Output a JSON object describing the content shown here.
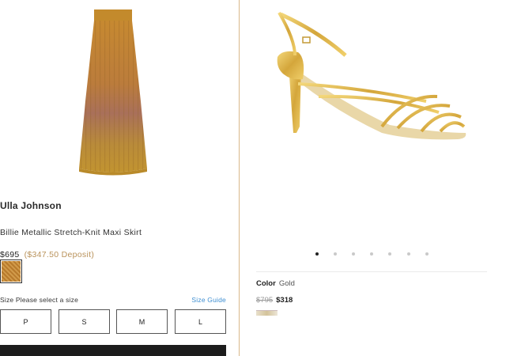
{
  "left_product": {
    "brand": "Ulla Johnson",
    "name": "Billie Metallic Stretch-Knit Maxi Skirt",
    "price": "$695",
    "deposit": "($347.50 Deposit)",
    "size_label": "Size",
    "size_prompt": "Please select a size",
    "size_guide": "Size Guide",
    "sizes": [
      "P",
      "S",
      "M",
      "L"
    ],
    "image_icon": "maxi-skirt-image"
  },
  "right_product": {
    "image_icon": "gold-strappy-sandal-image",
    "carousel_dots_count": 7,
    "carousel_active_index": 0,
    "color_label": "Color",
    "color_value": "Gold",
    "original_price": "$795",
    "sale_price": "$318"
  },
  "colors": {
    "deposit": "#b9925a",
    "size_guide_link": "#3f8fd2",
    "divider": "#d9b88a",
    "cart_bar": "#1c1c1c"
  }
}
